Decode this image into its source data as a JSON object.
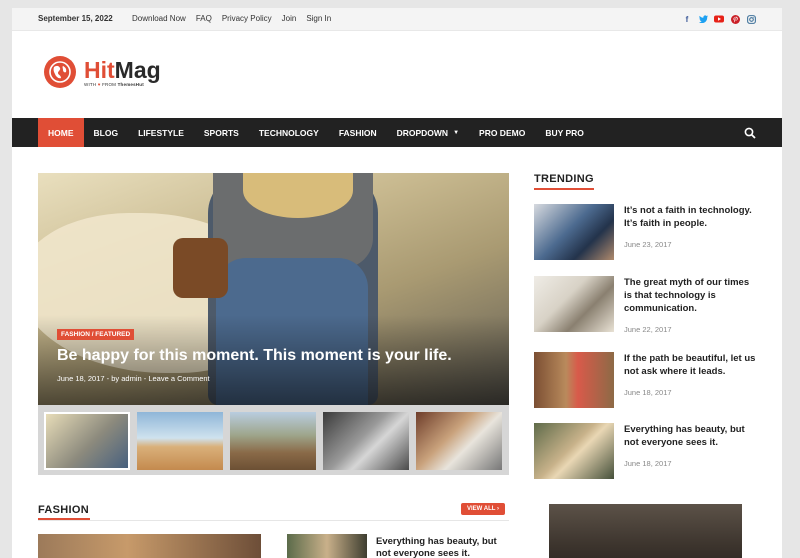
{
  "topbar": {
    "date": "September 15, 2022",
    "links": [
      "Download Now",
      "FAQ",
      "Privacy Policy",
      "Join",
      "Sign In"
    ],
    "social_icons": [
      "facebook-icon",
      "twitter-icon",
      "youtube-icon",
      "pinterest-icon",
      "instagram-icon"
    ]
  },
  "logo": {
    "name_part1": "Hit",
    "name_part2": "Mag",
    "tagline_pre": "WITH",
    "tagline_post": "FROM",
    "tagline_brand": "ThemesHut"
  },
  "nav": {
    "items": [
      "HOME",
      "BLOG",
      "LIFESTYLE",
      "SPORTS",
      "TECHNOLOGY",
      "FASHION",
      "DROPDOWN",
      "PRO DEMO",
      "BUY PRO"
    ]
  },
  "featured": {
    "category": "FASHION / FEATURED",
    "title": "Be happy for this moment. This moment is your life.",
    "date": "June 18, 2017",
    "author_prefix": "by",
    "author": "admin",
    "comment": "Leave a Comment"
  },
  "trending": {
    "heading": "TRENDING",
    "items": [
      {
        "title": "It’s not a faith in technology. It’s faith in people.",
        "date": "June 23, 2017"
      },
      {
        "title": "The great myth of our times is that technology is communication.",
        "date": "June 22, 2017"
      },
      {
        "title": "If the path be beautiful, let us not ask where it leads.",
        "date": "June 18, 2017"
      },
      {
        "title": "Everything has beauty, but not everyone sees it.",
        "date": "June 18, 2017"
      }
    ]
  },
  "fashion": {
    "heading": "FASHION",
    "view_all": "VIEW ALL",
    "item_title": "Everything has beauty, but not everyone sees it."
  },
  "colors": {
    "accent": "#e04e36",
    "nav_bg": "#222222"
  }
}
